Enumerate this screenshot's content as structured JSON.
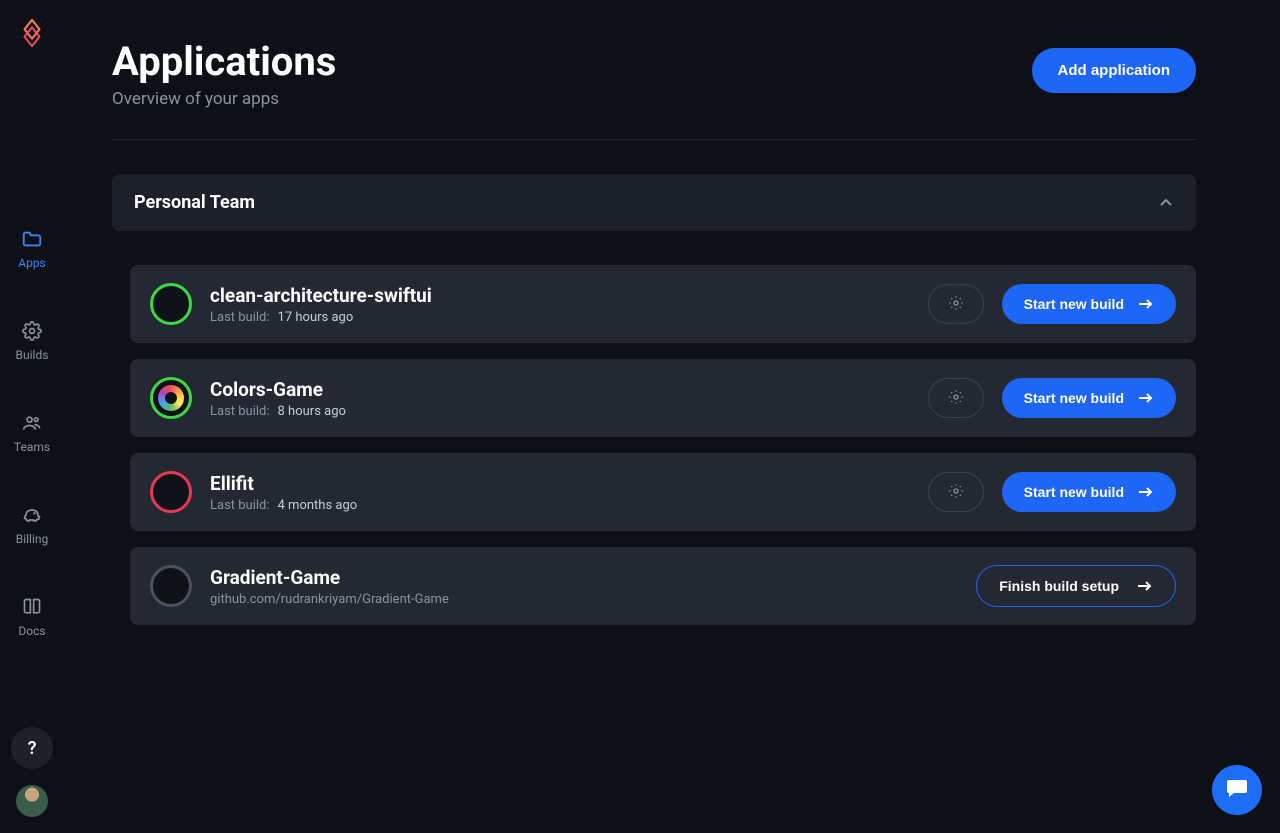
{
  "sidebar": {
    "items": [
      {
        "id": "apps",
        "label": "Apps",
        "active": true
      },
      {
        "id": "builds",
        "label": "Builds",
        "active": false
      },
      {
        "id": "teams",
        "label": "Teams",
        "active": false
      },
      {
        "id": "billing",
        "label": "Billing",
        "active": false
      },
      {
        "id": "docs",
        "label": "Docs",
        "active": false
      }
    ],
    "help_label": "?"
  },
  "header": {
    "title": "Applications",
    "subtitle": "Overview of your apps",
    "add_button": "Add application"
  },
  "team": {
    "name": "Personal Team",
    "expanded": true
  },
  "apps": [
    {
      "name": "clean-architecture-swiftui",
      "meta_label": "Last build:",
      "meta_value": "17 hours ago",
      "ring": "green",
      "action": "Start new build",
      "action_style": "primary",
      "has_gear": true,
      "icon": "none"
    },
    {
      "name": "Colors-Game",
      "meta_label": "Last build:",
      "meta_value": "8 hours ago",
      "ring": "green",
      "action": "Start new build",
      "action_style": "primary",
      "has_gear": true,
      "icon": "colors"
    },
    {
      "name": "Ellifit",
      "meta_label": "Last build:",
      "meta_value": "4 months ago",
      "ring": "red",
      "action": "Start new build",
      "action_style": "primary",
      "has_gear": true,
      "icon": "none"
    },
    {
      "name": "Gradient-Game",
      "meta_label": "",
      "meta_value": "github.com/rudrankriyam/Gradient-Game",
      "ring": "gray",
      "action": "Finish build setup",
      "action_style": "outline",
      "has_gear": false,
      "icon": "none"
    }
  ]
}
